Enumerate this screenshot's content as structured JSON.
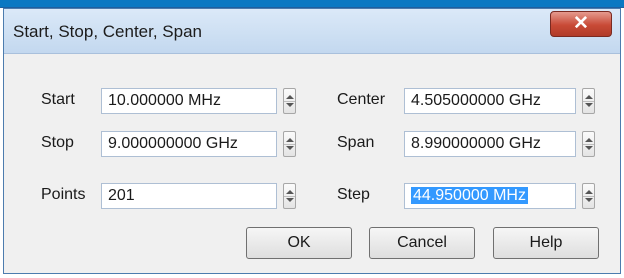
{
  "dialog": {
    "title": "Start, Stop, Center, Span",
    "close_label": "✕"
  },
  "fields": {
    "start": {
      "label": "Start",
      "value": "10.000000 MHz"
    },
    "stop": {
      "label": "Stop",
      "value": "9.000000000 GHz"
    },
    "points": {
      "label": "Points",
      "value": "201"
    },
    "center": {
      "label": "Center",
      "value": "4.505000000 GHz"
    },
    "span": {
      "label": "Span",
      "value": "8.990000000 GHz"
    },
    "step": {
      "label": "Step",
      "value": "44.950000 MHz"
    }
  },
  "buttons": {
    "ok": "OK",
    "cancel": "Cancel",
    "help": "Help"
  }
}
